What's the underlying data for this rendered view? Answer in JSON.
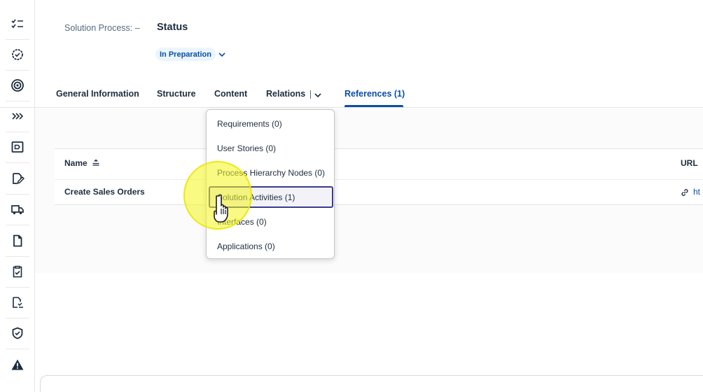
{
  "header": {
    "label": "Solution Process: –",
    "title": "Status",
    "status": "In Preparation"
  },
  "tabs": [
    {
      "label": "General Information"
    },
    {
      "label": "Structure"
    },
    {
      "label": "Content"
    },
    {
      "label": "Relations"
    },
    {
      "label": "References (1)"
    }
  ],
  "table": {
    "columns": [
      "Name",
      "URL"
    ],
    "rows": [
      {
        "name": "Create Sales Orders",
        "url": "ht"
      }
    ]
  },
  "menu": {
    "items": [
      {
        "label": "Requirements (0)"
      },
      {
        "label": "User Stories (0)"
      },
      {
        "label": "Process Hierarchy Nodes (0)"
      },
      {
        "label": "Solution Activities (1)"
      },
      {
        "label": "Interfaces (0)"
      },
      {
        "label": "Applications (0)"
      }
    ]
  },
  "colors": {
    "accent": "#0a4fa5",
    "highlight_border": "#3b3b8f",
    "cursor_highlight": "#f4f51c"
  },
  "icons": {
    "rail": [
      "task-list-icon",
      "settings-check-icon",
      "target-icon",
      "chevrons-right-icon",
      "presentation-icon",
      "edit-document-icon",
      "shipping-icon",
      "document-icon",
      "clipboard-check-icon",
      "cost-list-icon",
      "shield-check-icon",
      "warning-icon"
    ]
  }
}
